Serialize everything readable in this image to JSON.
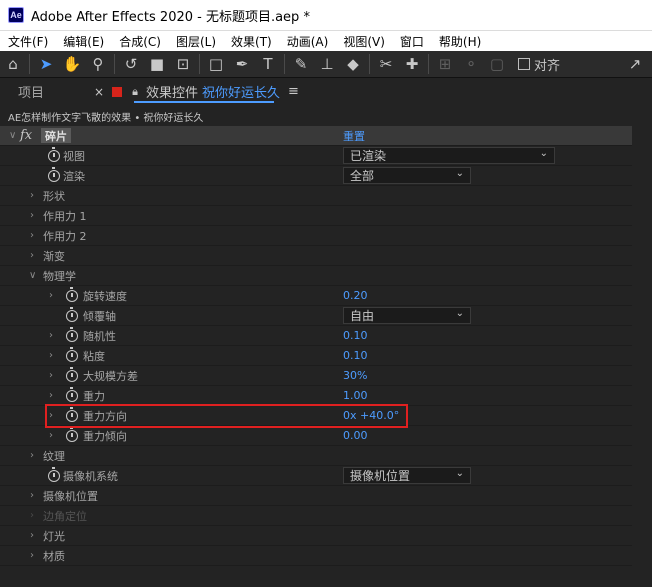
{
  "window": {
    "app_icon": "Ae",
    "title": "Adobe After Effects 2020 - 无标题项目.aep *"
  },
  "menu": [
    "文件(F)",
    "编辑(E)",
    "合成(C)",
    "图层(L)",
    "效果(T)",
    "动画(A)",
    "视图(V)",
    "窗口",
    "帮助(H)"
  ],
  "toolbar": {
    "tools": [
      "home-icon",
      "selection-arrow-icon",
      "hand-icon",
      "zoom-icon",
      "rotate-icon",
      "camera-icon",
      "pan-behind-icon",
      "rectangle-icon",
      "pen-icon",
      "text-icon",
      "brush-icon",
      "clone-stamp-icon",
      "eraser-icon",
      "roto-brush-icon",
      "puppet-pin-icon"
    ],
    "snap_label": "对齐"
  },
  "panel": {
    "project_tab": "项目",
    "effects_tab": "效果控件",
    "effects_layer": "祝你好运长久",
    "breadcrumb": "AE怎样制作文字飞散的效果 • 祝你好运长久"
  },
  "effect": {
    "name": "碎片",
    "reset": "重置",
    "rows": [
      {
        "label": "视图",
        "kind": "select",
        "value": "已渲染"
      },
      {
        "label": "渲染",
        "kind": "select",
        "value": "全部"
      },
      {
        "label": "形状",
        "kind": "group"
      },
      {
        "label": "作用力 1",
        "kind": "group"
      },
      {
        "label": "作用力 2",
        "kind": "group"
      },
      {
        "label": "渐变",
        "kind": "group"
      },
      {
        "label": "物理学",
        "kind": "group-open"
      },
      {
        "label": "旋转速度",
        "kind": "value",
        "value": "0.20"
      },
      {
        "label": "倾覆轴",
        "kind": "select",
        "value": "自由"
      },
      {
        "label": "随机性",
        "kind": "value",
        "value": "0.10"
      },
      {
        "label": "粘度",
        "kind": "value",
        "value": "0.10"
      },
      {
        "label": "大规模方差",
        "kind": "value",
        "value": "30%"
      },
      {
        "label": "重力",
        "kind": "value",
        "value": "1.00"
      },
      {
        "label": "重力方向",
        "kind": "value",
        "value": "0x +40.0°"
      },
      {
        "label": "重力倾向",
        "kind": "value",
        "value": "0.00"
      },
      {
        "label": "纹理",
        "kind": "group"
      },
      {
        "label": "摄像机系统",
        "kind": "select",
        "value": "摄像机位置"
      },
      {
        "label": "摄像机位置",
        "kind": "group"
      },
      {
        "label": "边角定位",
        "kind": "group-dim"
      },
      {
        "label": "灯光",
        "kind": "group"
      },
      {
        "label": "材质",
        "kind": "group"
      }
    ]
  },
  "colors": {
    "accent": "#4d9cff",
    "highlight": "#e02020",
    "panel_bg": "#232323"
  }
}
